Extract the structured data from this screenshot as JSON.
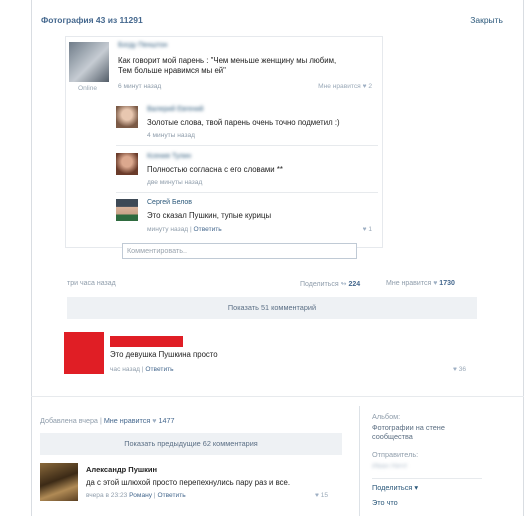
{
  "header": {
    "title": "Фотография 43 из 11291",
    "close": "Закрыть"
  },
  "photo_comments": [
    {
      "author": "Богду Пенштон",
      "text_line1": "Как говорит мой парень : \"Чем меньше женщину мы любим,",
      "text_line2": "Тем больше нравимся мы ей\"",
      "time": "6 минут назад",
      "status": "Online",
      "likes_label": "Мне нравится",
      "likes": "2"
    },
    {
      "author": "Валерий Евгений",
      "text": "Золотые слова, твой парень очень точно подметил :)",
      "time": "4 минуты назад"
    },
    {
      "author": "Ксения Тулин",
      "text": "Полностью согласна с его словами **",
      "time": "две минуты назад"
    },
    {
      "author": "Сергей Белов",
      "text": "Это сказал Пушкин, тупые курицы",
      "time": "минуту назад",
      "reply": "Ответить",
      "likes": "1"
    }
  ],
  "comment_placeholder": "Комментировать..",
  "photo_stats": {
    "time": "три часа назад",
    "share_label": "Поделиться",
    "shares": "224",
    "likes_label": "Мне нравится",
    "likes": "1730"
  },
  "show_comments": "Показать 51 комментарий",
  "girl_comment": {
    "text": "Это девушка Пушкина просто",
    "time": "час назад",
    "reply": "Ответить",
    "likes": "36"
  },
  "bottom_post": {
    "added": "Добавлена вчера",
    "likes_label": "Мне нравится",
    "likes": "1477",
    "show_prev": "Показать предыдущие 62 комментария",
    "comment_author": "Александр Пушкин",
    "comment_text": "да с этой шлюхой просто перепехнулись пару раз и все.",
    "comment_time": "вчера в 23:23",
    "comment_to": "Роману",
    "reply": "Ответить",
    "comment_likes": "15"
  },
  "sidebar": {
    "album_label": "Альбом:",
    "album_value_line1": "Фотографии на стене",
    "album_value_line2": "сообщества",
    "sender_label": "Отправитель:",
    "sender_value": "Иван Ничт",
    "share": "Поделиться",
    "more": "Это что"
  },
  "colors": {
    "link": "#2b587a",
    "meta": "#8f9dab",
    "red_block": "#e01e25",
    "button_bg": "#eef1f4"
  }
}
